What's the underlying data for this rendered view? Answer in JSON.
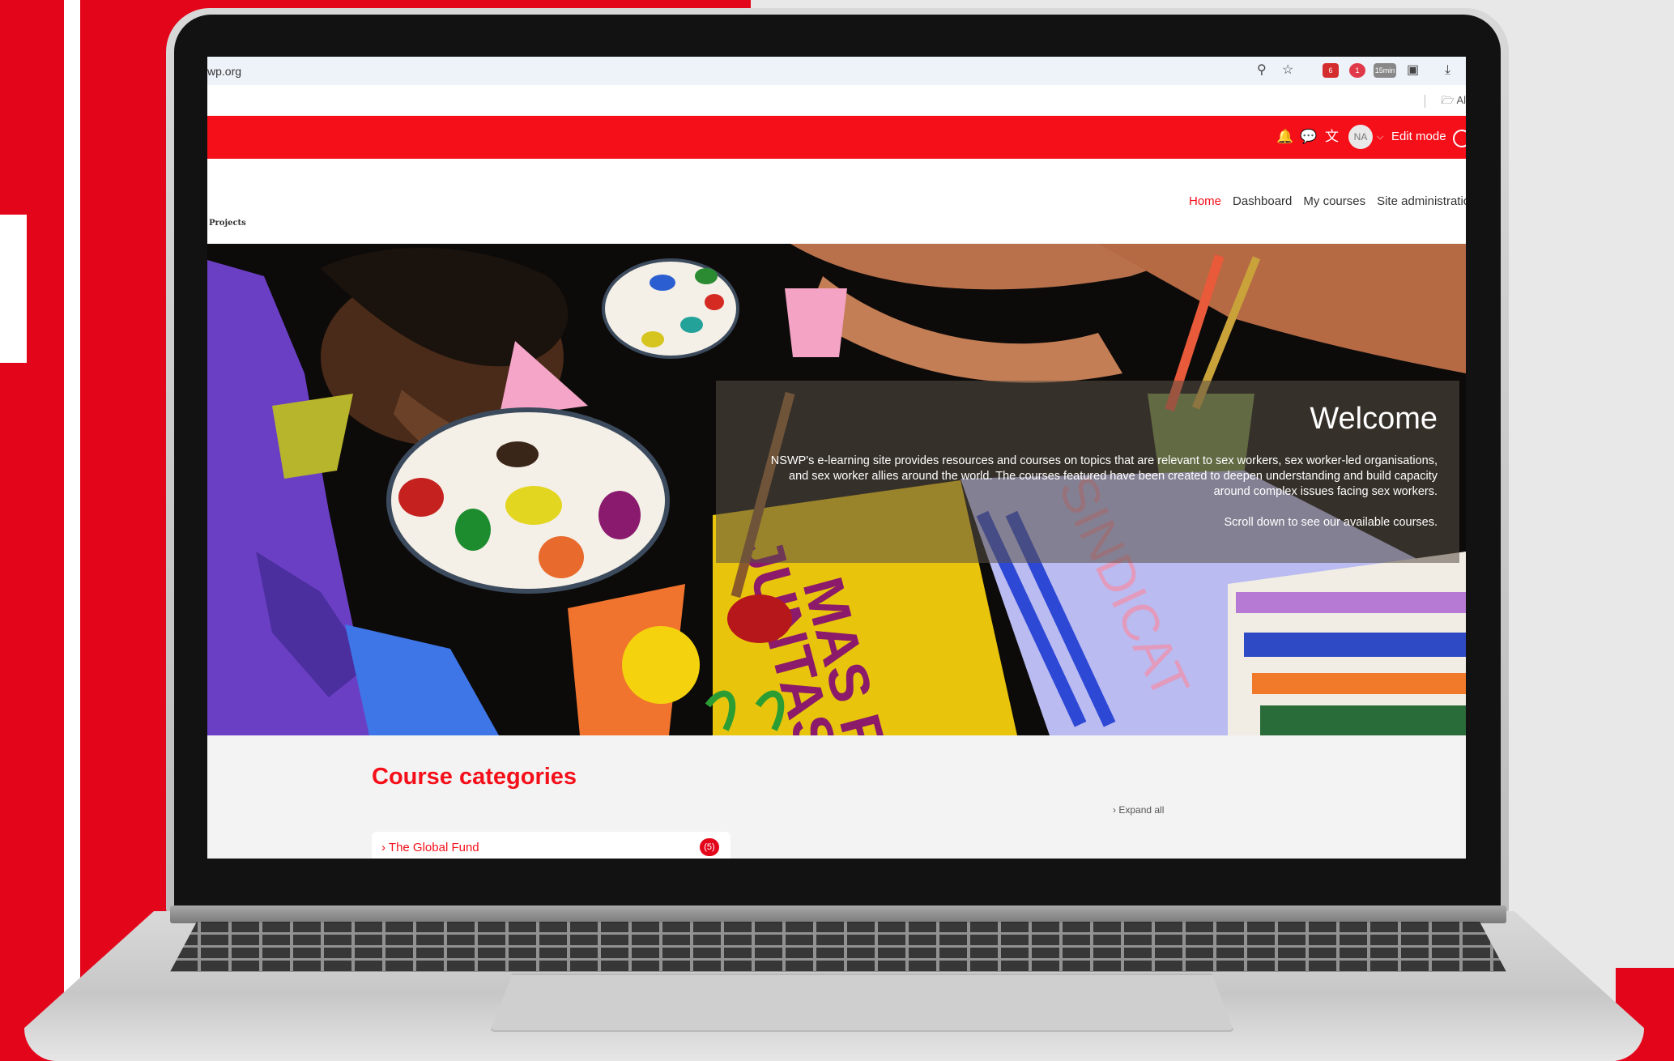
{
  "browser": {
    "url": "wp.org",
    "bookmarks_all": "Al",
    "extension_badges": [
      "6",
      "1",
      "15min"
    ]
  },
  "topnav": {
    "user_initials": "NA",
    "edit_mode_label": "Edit mode"
  },
  "site": {
    "logo_text": "Projects",
    "menu": [
      {
        "label": "Home",
        "active": true
      },
      {
        "label": "Dashboard",
        "active": false
      },
      {
        "label": "My courses",
        "active": false
      },
      {
        "label": "Site administratic",
        "active": false
      }
    ]
  },
  "hero": {
    "title": "Welcome",
    "text": "NSWP's e-learning site provides resources and courses on topics that are relevant to sex workers, sex worker-led organisations, and sex worker allies around the world. The courses featured have been created to deepen understanding and build capacity around complex issues facing sex workers.",
    "scroll_note": "Scroll down to see our available courses.",
    "artwork_lettering": [
      "MAS FUE",
      "JUNTAS",
      "SINDICAT"
    ]
  },
  "courses": {
    "heading": "Course categories",
    "expand_all": "Expand all",
    "categories": [
      {
        "name": "The Global Fund",
        "count": "(5)"
      }
    ]
  },
  "colors": {
    "brand_red": "#f50f19",
    "background_red": "#e3061b"
  }
}
